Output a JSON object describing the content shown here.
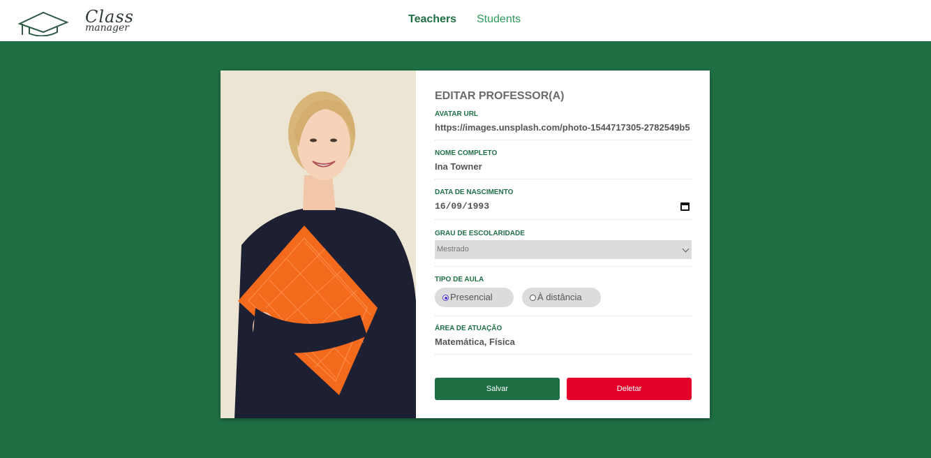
{
  "header": {
    "logo_line1": "Class",
    "logo_line2": "manager",
    "nav": {
      "teachers": "Teachers",
      "students": "Students"
    }
  },
  "form": {
    "title": "EDITAR PROFESSOR(A)",
    "avatar_url": {
      "label": "AVATAR URL",
      "value": "https://images.unsplash.com/photo-1544717305-2782549b5"
    },
    "full_name": {
      "label": "NOME COMPLETO",
      "value": "Ina Towner"
    },
    "birth_date": {
      "label": "DATA DE NASCIMENTO",
      "value": "16/09/1993"
    },
    "education": {
      "label": "GRAU DE ESCOLARIDADE",
      "selected": "Mestrado"
    },
    "class_type": {
      "label": "TIPO DE AULA",
      "options": [
        {
          "label": "Presencial",
          "checked": true
        },
        {
          "label": "À distância",
          "checked": false
        }
      ]
    },
    "area": {
      "label": "ÁREA DE ATUAÇÃO",
      "value": "Matemática, Física"
    },
    "save_label": "Salvar",
    "delete_label": "Deletar"
  },
  "colors": {
    "brand_green": "#1f6f45",
    "link_green": "#2f9a5a",
    "danger": "#e4002b",
    "radio_accent": "#4a30d8"
  }
}
